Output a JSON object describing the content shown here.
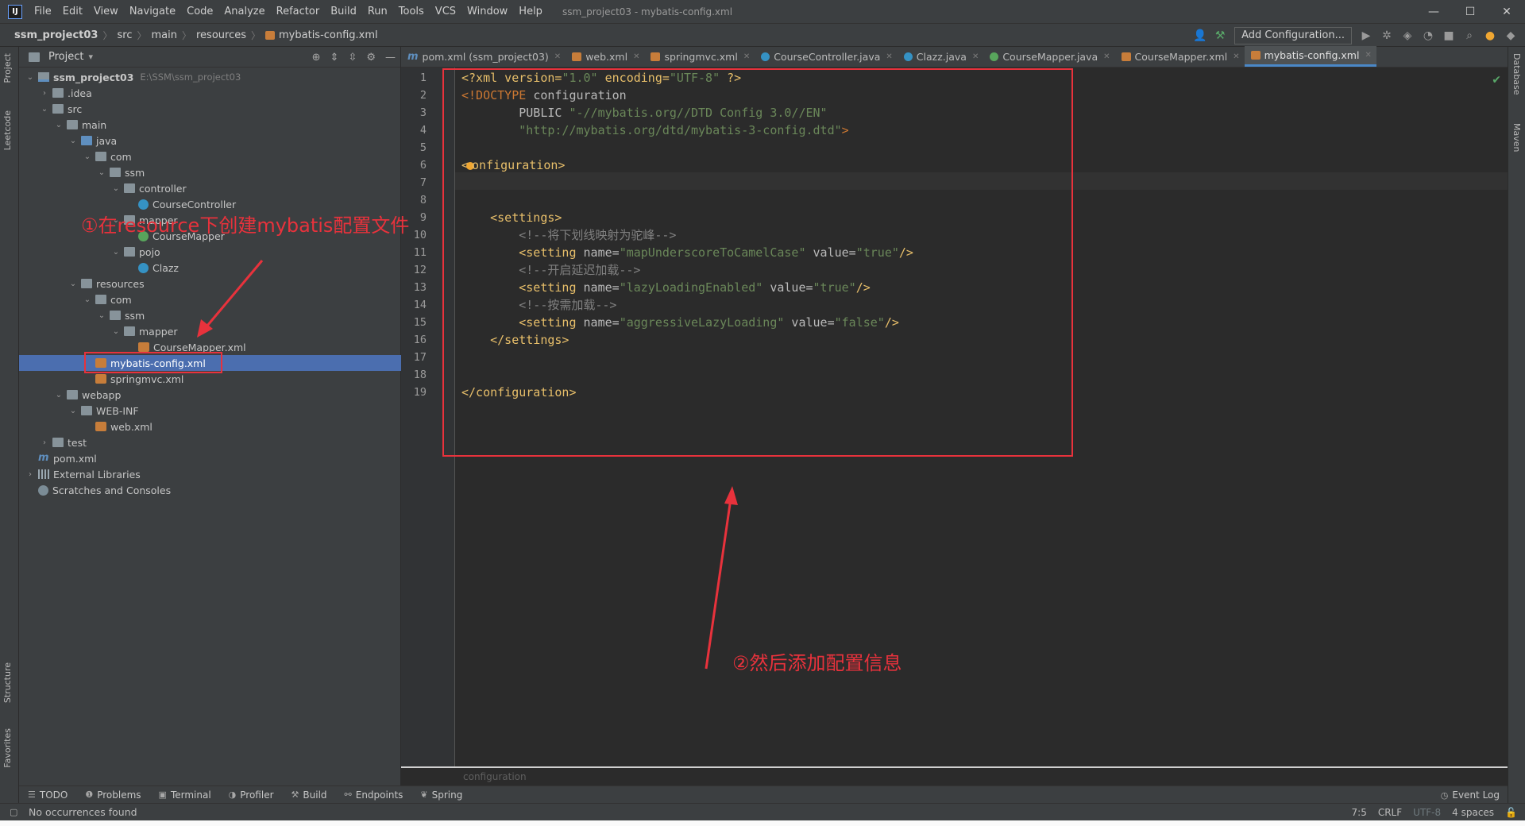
{
  "window": {
    "logo": "IJ",
    "title": "ssm_project03 - mybatis-config.xml",
    "controls": [
      "—",
      "☐",
      "✕"
    ]
  },
  "menu": [
    "File",
    "Edit",
    "View",
    "Navigate",
    "Code",
    "Analyze",
    "Refactor",
    "Build",
    "Run",
    "Tools",
    "VCS",
    "Window",
    "Help"
  ],
  "navbar": {
    "crumbs": [
      "ssm_project03",
      "src",
      "main",
      "resources",
      "mybatis-config.xml"
    ],
    "add_configuration": "Add Configuration..."
  },
  "left_strip": [
    "Project",
    "Leetcode",
    "Structure",
    "Favorites"
  ],
  "right_strip": [
    "Database",
    "Maven"
  ],
  "project_panel": {
    "title": "Project",
    "tree": [
      {
        "label": "ssm_project03",
        "hint": "E:\\SSM\\ssm_project03",
        "icon": "module",
        "arrow": "down"
      },
      {
        "label": ".idea",
        "icon": "folder",
        "arrow": "right"
      },
      {
        "label": "src",
        "icon": "folder",
        "arrow": "down"
      },
      {
        "label": "main",
        "icon": "folder",
        "arrow": "down"
      },
      {
        "label": "java",
        "icon": "folder-blue",
        "arrow": "down"
      },
      {
        "label": "com",
        "icon": "folder",
        "arrow": "down"
      },
      {
        "label": "ssm",
        "icon": "folder",
        "arrow": "down"
      },
      {
        "label": "controller",
        "icon": "folder",
        "arrow": "down"
      },
      {
        "label": "CourseController",
        "icon": "class",
        "arrow": ""
      },
      {
        "label": "mapper",
        "icon": "folder",
        "arrow": "down"
      },
      {
        "label": "CourseMapper",
        "icon": "interface",
        "arrow": ""
      },
      {
        "label": "pojo",
        "icon": "folder",
        "arrow": "down"
      },
      {
        "label": "Clazz",
        "icon": "class",
        "arrow": ""
      },
      {
        "label": "resources",
        "icon": "folder",
        "arrow": "down"
      },
      {
        "label": "com",
        "icon": "folder",
        "arrow": "down"
      },
      {
        "label": "ssm",
        "icon": "folder",
        "arrow": "down"
      },
      {
        "label": "mapper",
        "icon": "folder",
        "arrow": "down"
      },
      {
        "label": "CourseMapper.xml",
        "icon": "xml",
        "arrow": ""
      },
      {
        "label": "mybatis-config.xml",
        "icon": "xml",
        "arrow": "",
        "selected": true
      },
      {
        "label": "springmvc.xml",
        "icon": "xml",
        "arrow": ""
      },
      {
        "label": "webapp",
        "icon": "folder",
        "arrow": "down"
      },
      {
        "label": "WEB-INF",
        "icon": "folder",
        "arrow": "down"
      },
      {
        "label": "web.xml",
        "icon": "xml",
        "arrow": ""
      },
      {
        "label": "test",
        "icon": "folder",
        "arrow": "right"
      },
      {
        "label": "pom.xml",
        "icon": "m",
        "arrow": ""
      },
      {
        "label": "External Libraries",
        "icon": "lib",
        "arrow": "right"
      },
      {
        "label": "Scratches and Consoles",
        "icon": "scratch",
        "arrow": ""
      }
    ]
  },
  "tabs": [
    {
      "label": "pom.xml (ssm_project03)",
      "icon": "m"
    },
    {
      "label": "web.xml",
      "icon": "xml"
    },
    {
      "label": "springmvc.xml",
      "icon": "xml"
    },
    {
      "label": "CourseController.java",
      "icon": "cls"
    },
    {
      "label": "Clazz.java",
      "icon": "cls"
    },
    {
      "label": "CourseMapper.java",
      "icon": "ifc"
    },
    {
      "label": "CourseMapper.xml",
      "icon": "xml"
    },
    {
      "label": "mybatis-config.xml",
      "icon": "xml",
      "active": true
    }
  ],
  "editor": {
    "line_numbers": [
      "1",
      "2",
      "3",
      "4",
      "5",
      "6",
      "7",
      "8",
      "9",
      "10",
      "11",
      "12",
      "13",
      "14",
      "15",
      "16",
      "17",
      "18",
      "19"
    ],
    "lines": [
      [
        {
          "t": "pi",
          "v": "<?xml version="
        },
        {
          "t": "str",
          "v": "\"1.0\""
        },
        {
          "t": "pi",
          "v": " encoding="
        },
        {
          "t": "str",
          "v": "\"UTF-8\""
        },
        {
          "t": "pi",
          "v": " ?>"
        }
      ],
      [
        {
          "t": "dt",
          "v": "<!DOCTYPE "
        },
        {
          "t": "attr",
          "v": "configuration"
        }
      ],
      [
        {
          "t": "attr",
          "v": "        PUBLIC "
        },
        {
          "t": "str",
          "v": "\"-//mybatis.org//DTD Config 3.0//EN\""
        }
      ],
      [
        {
          "t": "str",
          "v": "        \"http://mybatis.org/dtd/mybatis-3-config.dtd\""
        },
        {
          "t": "dt",
          "v": ">"
        }
      ],
      [],
      [
        {
          "t": "tag",
          "v": "<"
        },
        {
          "t": "bulb",
          "v": ""
        },
        {
          "t": "tag",
          "v": "onfiguration>"
        }
      ],
      [],
      [],
      [
        {
          "t": "tag",
          "v": "    <settings>"
        }
      ],
      [
        {
          "t": "cmt",
          "v": "        <!--将下划线映射为驼峰-->"
        }
      ],
      [
        {
          "t": "tag",
          "v": "        <setting "
        },
        {
          "t": "attr",
          "v": "name="
        },
        {
          "t": "str",
          "v": "\"mapUnderscoreToCamelCase\""
        },
        {
          "t": "attr",
          "v": " value="
        },
        {
          "t": "str",
          "v": "\"true\""
        },
        {
          "t": "tag",
          "v": "/>"
        }
      ],
      [
        {
          "t": "cmt",
          "v": "        <!--开启延迟加载-->"
        }
      ],
      [
        {
          "t": "tag",
          "v": "        <setting "
        },
        {
          "t": "attr",
          "v": "name="
        },
        {
          "t": "str",
          "v": "\"lazyLoadingEnabled\""
        },
        {
          "t": "attr",
          "v": " value="
        },
        {
          "t": "str",
          "v": "\"true\""
        },
        {
          "t": "tag",
          "v": "/>"
        }
      ],
      [
        {
          "t": "cmt",
          "v": "        <!--按需加载-->"
        }
      ],
      [
        {
          "t": "tag",
          "v": "        <setting "
        },
        {
          "t": "attr",
          "v": "name="
        },
        {
          "t": "str",
          "v": "\"aggressiveLazyLoading\""
        },
        {
          "t": "attr",
          "v": " value="
        },
        {
          "t": "str",
          "v": "\"false\""
        },
        {
          "t": "tag",
          "v": "/>"
        }
      ],
      [
        {
          "t": "tag",
          "v": "    </settings>"
        }
      ],
      [],
      [],
      [
        {
          "t": "tag",
          "v": "</configuration>"
        }
      ]
    ],
    "breadcrumb": "configuration"
  },
  "tool_windows": [
    "TODO",
    "Problems",
    "Terminal",
    "Profiler",
    "Build",
    "Endpoints",
    "Spring"
  ],
  "event_log": "Event Log",
  "status": {
    "message": "No occurrences found",
    "position": "7:5",
    "line_sep": "CRLF",
    "encoding": "UTF-8",
    "indent": "4 spaces"
  },
  "annotations": {
    "step1": "①在resource下创建mybatis配置文件",
    "step2": "②然后添加配置信息"
  },
  "colors": {
    "annotation": "#e8323c",
    "selection": "#4b6eaf",
    "tag": "#e8bf6a",
    "string": "#6a8759",
    "comment": "#808080"
  }
}
